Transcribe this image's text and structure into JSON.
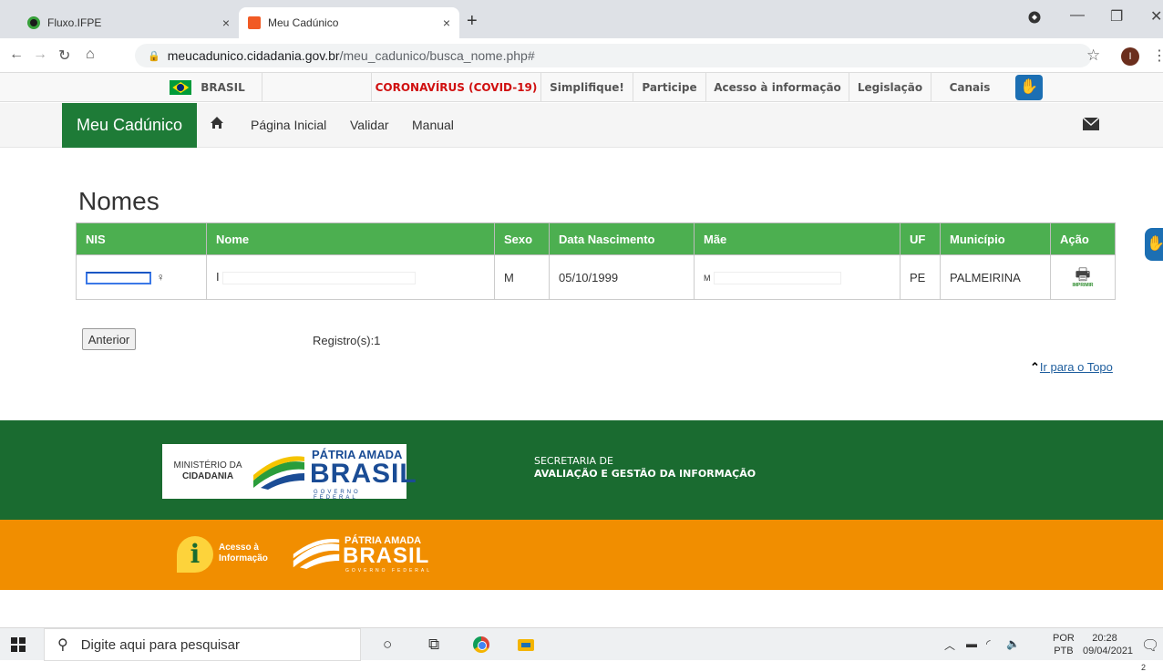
{
  "browser": {
    "tabs": [
      {
        "label": "Fluxo.IFPE",
        "close": "×"
      },
      {
        "label": "Meu Cadúnico",
        "close": "×"
      }
    ],
    "new_tab": "+",
    "url_host": "meucadunico.cidadania.gov.br",
    "url_path": "/meu_cadunico/busca_nome.php#",
    "profile_initial": "I"
  },
  "govbar": {
    "brasil": "BRASIL",
    "links": [
      "CORONAVÍRUS (COVID-19)",
      "Simplifique!",
      "Participe",
      "Acesso à informação",
      "Legislação",
      "Canais"
    ]
  },
  "nav": {
    "brand": "Meu Cadúnico",
    "links": [
      "Página Inicial",
      "Validar",
      "Manual"
    ]
  },
  "page": {
    "title": "Nomes",
    "columns": [
      "NIS",
      "Nome",
      "Sexo",
      "Data Nascimento",
      "Mãe",
      "UF",
      "Município",
      "Ação"
    ],
    "rows": [
      {
        "nis": "",
        "nome": "I",
        "sexo": "M",
        "data_nascimento": "05/10/1999",
        "mae": "M",
        "uf": "PE",
        "municipio": "PALMEIRINA",
        "acao": "IMPRIMIR"
      }
    ],
    "prev_label": "Anterior",
    "record_count": "Registro(s):1",
    "top_link": "Ir para o Topo"
  },
  "footer": {
    "ministerio_line1": "MINISTÉRIO DA",
    "ministerio_line2": "CIDADANIA",
    "patria": "PÁTRIA AMADA",
    "brasil": "BRASIL",
    "governo": "GOVERNO FEDERAL",
    "secretaria_line1": "SECRETARIA DE",
    "secretaria_line2": "AVALIAÇÃO E GESTÃO DA INFORMAÇÃO",
    "acesso_line1": "Acesso à",
    "acesso_line2": "Informação"
  },
  "taskbar": {
    "search_placeholder": "Digite aqui para pesquisar",
    "lang_top": "POR",
    "lang_bottom": "PTB",
    "time": "20:28",
    "date": "09/04/2021",
    "notif_count": "2"
  },
  "colors": {
    "brand_green": "#1e7b37",
    "table_header": "#4caf50",
    "footer_green": "#1a6b30",
    "footer_orange": "#f18e00",
    "covid_red": "#d01010"
  }
}
